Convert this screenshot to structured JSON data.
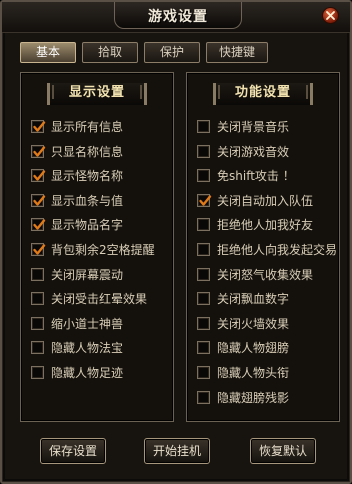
{
  "window": {
    "title": "游戏设置"
  },
  "tabs": [
    {
      "label": "基本",
      "active": true
    },
    {
      "label": "拾取",
      "active": false
    },
    {
      "label": "保护",
      "active": false
    },
    {
      "label": "快捷键",
      "active": false
    }
  ],
  "left_panel": {
    "title": "显示设置",
    "items": [
      {
        "label": "显示所有信息",
        "checked": true
      },
      {
        "label": "只显名称信息",
        "checked": true
      },
      {
        "label": "显示怪物名称",
        "checked": true
      },
      {
        "label": "显示血条与值",
        "checked": true
      },
      {
        "label": "显示物品名字",
        "checked": true
      },
      {
        "label": "背包剩余2空格提醒",
        "checked": true
      },
      {
        "label": "关闭屏幕震动",
        "checked": false
      },
      {
        "label": "关闭受击红晕效果",
        "checked": false
      },
      {
        "label": "缩小道士神兽",
        "checked": false
      },
      {
        "label": "隐藏人物法宝",
        "checked": false
      },
      {
        "label": "隐藏人物足迹",
        "checked": false
      }
    ]
  },
  "right_panel": {
    "title": "功能设置",
    "items": [
      {
        "label": "关闭背景音乐",
        "checked": false
      },
      {
        "label": "关闭游戏音效",
        "checked": false
      },
      {
        "label": "免shift攻击 ！",
        "checked": false
      },
      {
        "label": "关闭自动加入队伍",
        "checked": true
      },
      {
        "label": "拒绝他人加我好友",
        "checked": false
      },
      {
        "label": "拒绝他人向我发起交易",
        "checked": false
      },
      {
        "label": "关闭怒气收集效果",
        "checked": false
      },
      {
        "label": "关闭飘血数字",
        "checked": false
      },
      {
        "label": "关闭火墙效果",
        "checked": false
      },
      {
        "label": "隐藏人物翅膀",
        "checked": false
      },
      {
        "label": "隐藏人物头衔",
        "checked": false
      },
      {
        "label": "隐藏翅膀残影",
        "checked": false
      }
    ]
  },
  "buttons": {
    "save": "保存设置",
    "start": "开始挂机",
    "restore": "恢复默认"
  }
}
